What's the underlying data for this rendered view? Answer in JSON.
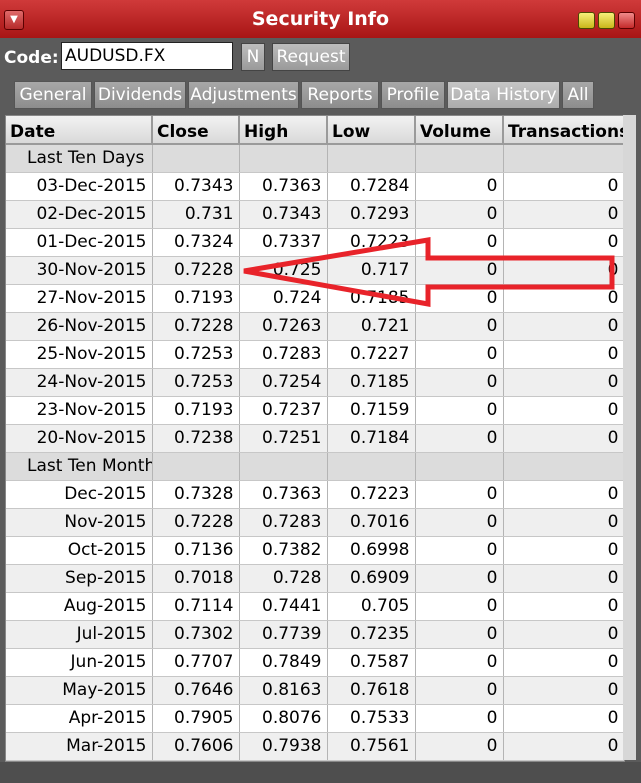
{
  "window": {
    "title": "Security Info"
  },
  "codebar": {
    "label": "Code:",
    "value": "AUDUSD.FX",
    "n_label": "N",
    "request_label": "Request"
  },
  "tabs": [
    {
      "label": "General"
    },
    {
      "label": "Dividends"
    },
    {
      "label": "Adjustments"
    },
    {
      "label": "Reports"
    },
    {
      "label": "Profile"
    },
    {
      "label": "Data History"
    },
    {
      "label": "All"
    }
  ],
  "table": {
    "headers": [
      "Date",
      "Close",
      "High",
      "Low",
      "Volume",
      "Transactions"
    ],
    "group1": {
      "label": "Last Ten Days"
    },
    "days": [
      {
        "date": "03-Dec-2015",
        "close": "0.7343",
        "high": "0.7363",
        "low": "0.7284",
        "volume": "0",
        "transactions": "0"
      },
      {
        "date": "02-Dec-2015",
        "close": "0.731",
        "high": "0.7343",
        "low": "0.7293",
        "volume": "0",
        "transactions": "0"
      },
      {
        "date": "01-Dec-2015",
        "close": "0.7324",
        "high": "0.7337",
        "low": "0.7223",
        "volume": "0",
        "transactions": "0"
      },
      {
        "date": "30-Nov-2015",
        "close": "0.7228",
        "high": "0.725",
        "low": "0.717",
        "volume": "0",
        "transactions": "0"
      },
      {
        "date": "27-Nov-2015",
        "close": "0.7193",
        "high": "0.724",
        "low": "0.7185",
        "volume": "0",
        "transactions": "0"
      },
      {
        "date": "26-Nov-2015",
        "close": "0.7228",
        "high": "0.7263",
        "low": "0.721",
        "volume": "0",
        "transactions": "0"
      },
      {
        "date": "25-Nov-2015",
        "close": "0.7253",
        "high": "0.7283",
        "low": "0.7227",
        "volume": "0",
        "transactions": "0"
      },
      {
        "date": "24-Nov-2015",
        "close": "0.7253",
        "high": "0.7254",
        "low": "0.7185",
        "volume": "0",
        "transactions": "0"
      },
      {
        "date": "23-Nov-2015",
        "close": "0.7193",
        "high": "0.7237",
        "low": "0.7159",
        "volume": "0",
        "transactions": "0"
      },
      {
        "date": "20-Nov-2015",
        "close": "0.7238",
        "high": "0.7251",
        "low": "0.7184",
        "volume": "0",
        "transactions": "0"
      }
    ],
    "group2": {
      "label": "Last Ten Months"
    },
    "months": [
      {
        "date": "Dec-2015",
        "close": "0.7328",
        "high": "0.7363",
        "low": "0.7223",
        "volume": "0",
        "transactions": "0"
      },
      {
        "date": "Nov-2015",
        "close": "0.7228",
        "high": "0.7283",
        "low": "0.7016",
        "volume": "0",
        "transactions": "0"
      },
      {
        "date": "Oct-2015",
        "close": "0.7136",
        "high": "0.7382",
        "low": "0.6998",
        "volume": "0",
        "transactions": "0"
      },
      {
        "date": "Sep-2015",
        "close": "0.7018",
        "high": "0.728",
        "low": "0.6909",
        "volume": "0",
        "transactions": "0"
      },
      {
        "date": "Aug-2015",
        "close": "0.7114",
        "high": "0.7441",
        "low": "0.705",
        "volume": "0",
        "transactions": "0"
      },
      {
        "date": "Jul-2015",
        "close": "0.7302",
        "high": "0.7739",
        "low": "0.7235",
        "volume": "0",
        "transactions": "0"
      },
      {
        "date": "Jun-2015",
        "close": "0.7707",
        "high": "0.7849",
        "low": "0.7587",
        "volume": "0",
        "transactions": "0"
      },
      {
        "date": "May-2015",
        "close": "0.7646",
        "high": "0.8163",
        "low": "0.7618",
        "volume": "0",
        "transactions": "0"
      },
      {
        "date": "Apr-2015",
        "close": "0.7905",
        "high": "0.8076",
        "low": "0.7533",
        "volume": "0",
        "transactions": "0"
      },
      {
        "date": "Mar-2015",
        "close": "0.7606",
        "high": "0.7938",
        "low": "0.7561",
        "volume": "0",
        "transactions": "0"
      }
    ]
  },
  "annotation": {
    "color": "#e8232a"
  }
}
